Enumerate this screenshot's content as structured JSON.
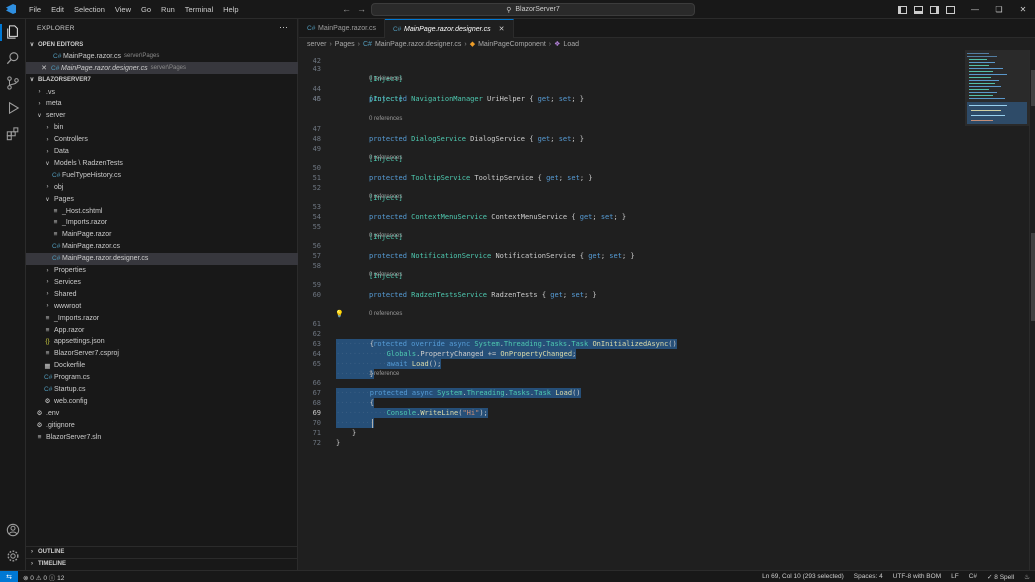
{
  "menu": [
    "File",
    "Edit",
    "Selection",
    "View",
    "Go",
    "Run",
    "Terminal",
    "Help"
  ],
  "command_center": {
    "text": "BlazorServer7"
  },
  "explorer": {
    "title": "EXPLORER",
    "open_editors": {
      "label": "OPEN EDITORS",
      "items": [
        {
          "name": "MainPage.razor.cs",
          "path": "server\\Pages"
        },
        {
          "name": "MainPage.razor.designer.cs",
          "path": "server\\Pages"
        }
      ]
    },
    "project": {
      "label": "BLAZORSERVER7",
      "tree": [
        {
          "name": ".vs",
          "kind": "folder"
        },
        {
          "name": "meta",
          "kind": "folder"
        },
        {
          "name": "server",
          "kind": "folder-open"
        },
        {
          "name": "bin",
          "kind": "folder"
        },
        {
          "name": "Controllers",
          "kind": "folder"
        },
        {
          "name": "Data",
          "kind": "folder"
        },
        {
          "name": "Models \\ RadzenTests",
          "kind": "folder-open"
        },
        {
          "name": "FuelTypeHistory.cs",
          "kind": "cs"
        },
        {
          "name": "obj",
          "kind": "folder"
        },
        {
          "name": "Pages",
          "kind": "folder-open"
        },
        {
          "name": "_Host.cshtml",
          "kind": "razor"
        },
        {
          "name": "_Imports.razor",
          "kind": "razor"
        },
        {
          "name": "MainPage.razor",
          "kind": "razor"
        },
        {
          "name": "MainPage.razor.cs",
          "kind": "cs"
        },
        {
          "name": "MainPage.razor.designer.cs",
          "kind": "cs"
        },
        {
          "name": "Properties",
          "kind": "folder"
        },
        {
          "name": "Services",
          "kind": "folder"
        },
        {
          "name": "Shared",
          "kind": "folder"
        },
        {
          "name": "wwwroot",
          "kind": "folder"
        },
        {
          "name": "_Imports.razor",
          "kind": "razor"
        },
        {
          "name": "App.razor",
          "kind": "razor"
        },
        {
          "name": "appsettings.json",
          "kind": "json"
        },
        {
          "name": "BlazorServer7.csproj",
          "kind": "razor"
        },
        {
          "name": "Dockerfile",
          "kind": "docker"
        },
        {
          "name": "Program.cs",
          "kind": "cs"
        },
        {
          "name": "Startup.cs",
          "kind": "cs"
        },
        {
          "name": "web.config",
          "kind": "config"
        },
        {
          "name": ".env",
          "kind": "gear"
        },
        {
          "name": ".gitignore",
          "kind": "gear"
        },
        {
          "name": "BlazorServer7.sln",
          "kind": "razor"
        }
      ]
    },
    "outline_label": "OUTLINE",
    "timeline_label": "TIMELINE"
  },
  "tabs": [
    {
      "label": "MainPage.razor.cs",
      "active": false
    },
    {
      "label": "MainPage.razor.designer.cs",
      "active": true
    }
  ],
  "breadcrumb": [
    "server",
    "Pages",
    "MainPage.razor.designer.cs",
    "MainPageComponent",
    "Load"
  ],
  "editor": {
    "codelens_0": "0 references",
    "codelens_1": "1 reference",
    "lines": {
      "43": "[Inject]",
      "44": "protected NavigationManager UriHelper { get; set; }",
      "45": "",
      "46": "[Inject]",
      "47": "protected DialogService DialogService { get; set; }",
      "48": "",
      "49": "[Inject]",
      "50": "protected TooltipService TooltipService { get; set; }",
      "51": "",
      "52": "[Inject]",
      "53": "protected ContextMenuService ContextMenuService { get; set; }",
      "54": "",
      "55": "[Inject]",
      "56": "protected NotificationService NotificationService { get; set; }",
      "57": "",
      "58": "[Inject]",
      "59": "protected RadzenTestsService RadzenTests { get; set; }",
      "60": "",
      "61": "protected override async System.Threading.Tasks.Task OnInitializedAsync()",
      "62": "{",
      "63": "Globals.PropertyChanged += OnPropertyChanged;",
      "64": "await Load();",
      "65": "}",
      "66": "protected async System.Threading.Tasks.Task Load()",
      "67": "{",
      "68": "Console.WriteLine(\"Hi\");",
      "69": "",
      "70": "}",
      "71": "}",
      "72": ""
    },
    "line_numbers": [
      "42",
      "43",
      "44",
      "45",
      "46",
      "47",
      "48",
      "49",
      "50",
      "51",
      "52",
      "53",
      "54",
      "55",
      "56",
      "57",
      "58",
      "59",
      "60",
      "61",
      "62",
      "63",
      "64",
      "65",
      "66",
      "67",
      "68",
      "69",
      "70",
      "71",
      "72"
    ]
  },
  "status": {
    "errors": "0",
    "warnings": "0",
    "info": "12",
    "position": "Ln 69, Col 10 (293 selected)",
    "spaces": "Spaces: 4",
    "encoding": "UTF-8 with BOM",
    "eol": "LF",
    "language": "C#",
    "spell": "8 Spell"
  },
  "colors": {
    "accent": "#0078d4",
    "selection": "#264f78",
    "keyword": "#569cd6",
    "type": "#4ec9b0",
    "method": "#dcdcaa",
    "string": "#ce9178"
  }
}
